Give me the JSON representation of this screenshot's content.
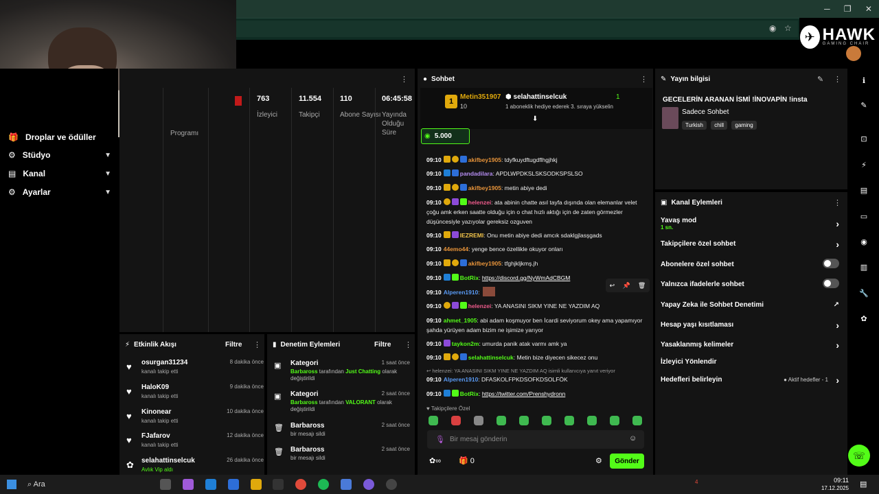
{
  "window": {
    "minimize": "─",
    "restore": "❐",
    "close": "✕"
  },
  "brand": {
    "logo_text": "HAWK",
    "logo_sub": "GAMING CHAIR"
  },
  "left_nav": [
    {
      "label": "Droplar ve ödüller",
      "icon": "gift-icon"
    },
    {
      "label": "Stüdyo",
      "icon": "studio-icon"
    },
    {
      "label": "Kanal",
      "icon": "channel-icon"
    },
    {
      "label": "Ayarlar",
      "icon": "gear-icon"
    }
  ],
  "stats": {
    "program_label": "Programı",
    "items": [
      {
        "value": "763",
        "label": "İzleyici"
      },
      {
        "value": "11.554",
        "label": "Takipçi"
      },
      {
        "value": "110",
        "label": "Abone Sayısı"
      },
      {
        "value": "06:45:58",
        "label": "Yayında Olduğu Süre"
      }
    ]
  },
  "activity": {
    "title": "Etkinlik Akışı",
    "filter": "Filtre",
    "items": [
      {
        "name": "osurgan31234",
        "sub": "kanalı takip etti",
        "time": "8 dakika önce"
      },
      {
        "name": "HaloK09",
        "sub": "kanalı takip etti",
        "time": "9 dakika önce"
      },
      {
        "name": "Kinonear",
        "sub": "kanalı takip etti",
        "time": "10 dakika önce"
      },
      {
        "name": "FJafarov",
        "sub": "kanalı takip etti",
        "time": "12 dakika önce"
      },
      {
        "name": "selahattinselcuk",
        "sub": "Avlık Vip aldı",
        "time": "26 dakika önce"
      }
    ]
  },
  "moderation": {
    "title": "Denetim Eylemleri",
    "filter": "Filtre",
    "items": [
      {
        "name": "Kategori",
        "by": "Barbaross",
        "mid": " tarafından ",
        "game": "Just Chatting",
        "end": " olarak değiştirildi",
        "time": "1 saat önce"
      },
      {
        "name": "Kategori",
        "by": "Barbaross",
        "mid": " tarafından ",
        "game": "VALORANT",
        "end": " olarak değiştirildi",
        "time": "2 saat önce"
      },
      {
        "name": "Barbaross",
        "sub": "bir mesajı sildi",
        "time": "2 saat önce"
      },
      {
        "name": "Barbaross",
        "sub": "bir mesajı sildi",
        "time": "2 saat önce"
      }
    ]
  },
  "chat": {
    "title": "Sohbet",
    "top_user": "Metin351907",
    "top_level": "10",
    "gift_user": "selahattinselcuk",
    "gift_count": "1",
    "gift_text": "1 aboneklik hediye ederek 3. sıraya yükselin",
    "points": "5.000",
    "messages": [
      {
        "time": "09:10",
        "user": "akifbey1905",
        "color": "u-orange",
        "text": ": tdyfkuydftugdflhgjhkj",
        "badges": [
          "b-crown",
          "b-one",
          "b-blue"
        ]
      },
      {
        "time": "09:10",
        "user": "pandadilara",
        "color": "u-purple",
        "text": ": APDLWPDKSLSKSODKSPSLSO",
        "badges": [
          "b-bot",
          "b-blue"
        ]
      },
      {
        "time": "09:10",
        "user": "akifbey1905",
        "color": "u-orange",
        "text": ": metin abiye dedi",
        "badges": [
          "b-crown",
          "b-one",
          "b-blue"
        ]
      },
      {
        "time": "09:10",
        "user": "helenzei",
        "color": "u-pink",
        "text": ": ata abinin chatte asıl tayfa dışında olan elemanlar velet çoğu amk erken saatte olduğu için o chat hızlı aktığı için de zaten görmezler düşüncesiyle yazıyolar gereksiz ozguven",
        "badges": [
          "b-one",
          "b-vip",
          "b-green"
        ]
      },
      {
        "time": "09:10",
        "user": "IEZREMI",
        "color": "u-yellow",
        "text": ": Onu metin abiye dedi amcık sdaklgjlasşgads",
        "badges": [
          "b-crown",
          "b-vip"
        ]
      },
      {
        "time": "09:10",
        "user": "44emo44",
        "color": "u-orange",
        "text": ": yenge bence özellikle okuyor onları",
        "badges": []
      },
      {
        "time": "09:10",
        "user": "akifbey1905",
        "color": "u-orange",
        "text": ": tfghjkljkmş.jh",
        "badges": [
          "b-crown",
          "b-one",
          "b-blue"
        ]
      },
      {
        "time": "09:10",
        "user": "BotRix",
        "color": "u-green",
        "text": ": ",
        "link": "https://discord.gg/NyWmAdCBGM",
        "badges": [
          "b-bot",
          "b-green"
        ]
      },
      {
        "time": "09:10",
        "user": "Alperen1910",
        "color": "u-blue",
        "text": ": ",
        "badges": []
      },
      {
        "time": "09:10",
        "user": "helenzei",
        "color": "u-pink",
        "text": ": YA ANASINI SIKM YINE NE YAZDIM AQ",
        "badges": [
          "b-one",
          "b-vip",
          "b-green"
        ]
      },
      {
        "time": "09:10",
        "user": "ahmet_1905",
        "color": "u-green",
        "text": ": abi adam koşmuyor ben İcardi seviyorum okey ama yapamıyor şahda yürüyen adam bizim ne işimize yarıyor",
        "badges": []
      },
      {
        "time": "09:10",
        "user": "taykon2m",
        "color": "u-green",
        "text": ": umurda panik atak varmı amk ya",
        "badges": [
          "b-vip"
        ]
      },
      {
        "time": "09:10",
        "user": "selahattinselcuk",
        "color": "u-green",
        "text": ": Metin bize diyecen sikecez onu",
        "badges": [
          "b-crown",
          "b-one",
          "b-blue"
        ]
      },
      {
        "time": "",
        "user": "",
        "color": "",
        "text": "↩ helenzei: YA ANASINI SIKM YINE NE YAZDIM AQ isimli kullanıcıya yanıt veriyor",
        "badges": [],
        "reply": true
      },
      {
        "time": "09:10",
        "user": "Alperen1910",
        "color": "u-blue",
        "text": ": DFASKOLFPKDSOFKDSOLFÖK",
        "badges": []
      },
      {
        "time": "09:10",
        "user": "BotRix",
        "color": "u-green",
        "text": ": ",
        "link": "https://twitter.com/Prenshydronn",
        "badges": [
          "b-bot",
          "b-green"
        ]
      }
    ],
    "emote_label": "♥ Takipçilere Özel",
    "input_placeholder": "Bir mesaj gönderin",
    "count": "0",
    "send": "Gönder"
  },
  "stream_info": {
    "title": "Yayın bilgisi",
    "stream_title": "GECELERİN ARANAN İSMİ !İNOVAPİN !insta",
    "category": "Sadece Sohbet",
    "tags": [
      "Turkish",
      "chill",
      "gaming"
    ]
  },
  "channel_actions": {
    "title": "Kanal Eylemleri",
    "slow_mode": "Yavaş mod",
    "slow_value": "1 sn.",
    "items": [
      {
        "label": "Takipçilere özel sohbet",
        "kind": "arrow"
      },
      {
        "label": "Abonelere özel sohbet",
        "kind": "toggle"
      },
      {
        "label": "Yalnızca ifadelerle sohbet",
        "kind": "toggle"
      },
      {
        "label": "Yapay Zeka ile Sohbet Denetimi",
        "kind": "ext"
      },
      {
        "label": "Hesap yaşı kısıtlaması",
        "kind": "arrow"
      },
      {
        "label": "Yasaklanmış kelimeler",
        "kind": "arrow"
      },
      {
        "label": "İzleyici Yönlendir",
        "kind": "none"
      },
      {
        "label": "Hedefleri belirleyin",
        "kind": "arrow"
      }
    ],
    "goals_status": "● Aktif hedefler - 1"
  },
  "taskbar": {
    "search": "Ara",
    "time": "09:11",
    "date": "17.12.2025",
    "notif": "4"
  },
  "colors": {
    "accent": "#53fc18",
    "panel": "#141414"
  }
}
